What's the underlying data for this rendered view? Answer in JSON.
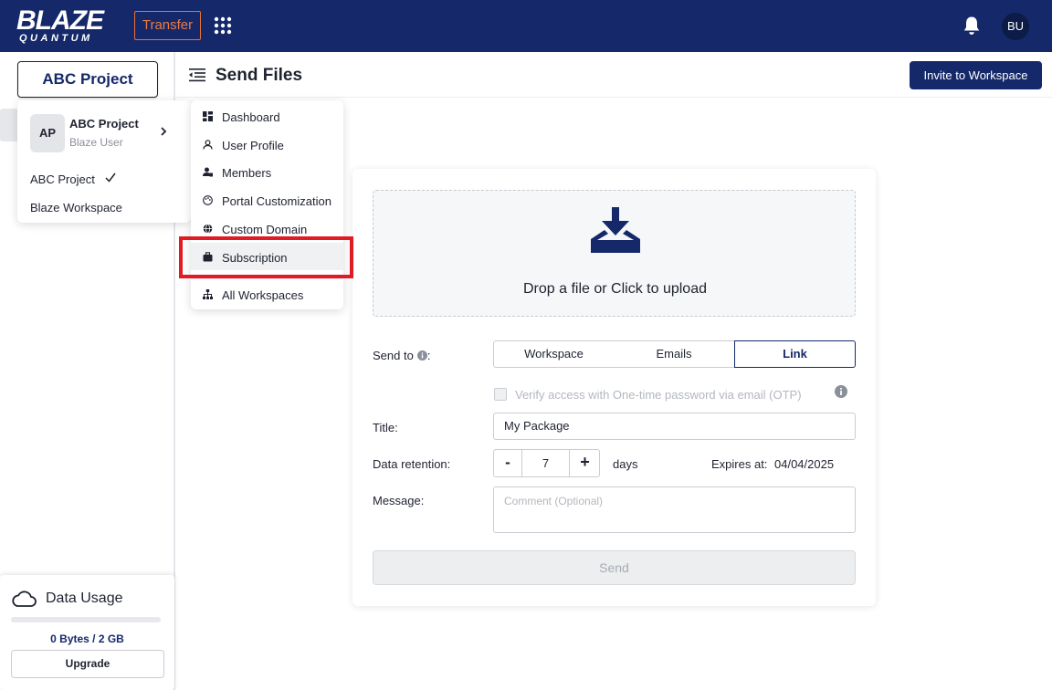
{
  "app": {
    "logo_main": "BLAZE",
    "logo_sub": "QUANTUM",
    "transfer_label": "Transfer",
    "user_initials": "BU"
  },
  "sidebar": {
    "project_button_label": "ABC Project",
    "data_usage": {
      "title": "Data Usage",
      "usage_text": "0 Bytes / 2 GB",
      "used_fraction": 0,
      "upgrade_label": "Upgrade"
    }
  },
  "header": {
    "title": "Send Files",
    "invite_label": "Invite to Workspace"
  },
  "project_dropdown": {
    "avatar_initials": "AP",
    "project_name": "ABC Project",
    "user_name": "Blaze User",
    "items": [
      {
        "label": "ABC Project",
        "checked": true
      },
      {
        "label": "Blaze Workspace",
        "checked": false
      }
    ]
  },
  "workspace_menu": {
    "items": [
      {
        "label": "Dashboard",
        "icon": "dashboard-icon"
      },
      {
        "label": "User Profile",
        "icon": "user-icon"
      },
      {
        "label": "Members",
        "icon": "members-icon"
      },
      {
        "label": "Portal Customization",
        "icon": "palette-icon"
      },
      {
        "label": "Custom Domain",
        "icon": "globe-icon"
      },
      {
        "label": "Subscription",
        "icon": "briefcase-icon",
        "highlighted": true
      },
      {
        "label": "All Workspaces",
        "icon": "sitemap-icon"
      }
    ]
  },
  "upload": {
    "drop_text": "Drop a file or Click to upload",
    "send_to_label": "Send to",
    "send_to_options": [
      "Workspace",
      "Emails",
      "Link"
    ],
    "send_to_selected": "Link",
    "otp_label": "Verify access with One-time password via email (OTP)",
    "title_label": "Title:",
    "title_value": "My Package",
    "retention_label": "Data retention:",
    "retention_value": "7",
    "retention_unit": "days",
    "expires_label": "Expires at:",
    "expires_value": "04/04/2025",
    "message_label": "Message:",
    "message_placeholder": "Comment (Optional)",
    "send_label": "Send"
  },
  "colors": {
    "brand_navy": "#14286a",
    "transfer_orange": "#ee7a43",
    "highlight_red": "#e01b24"
  }
}
